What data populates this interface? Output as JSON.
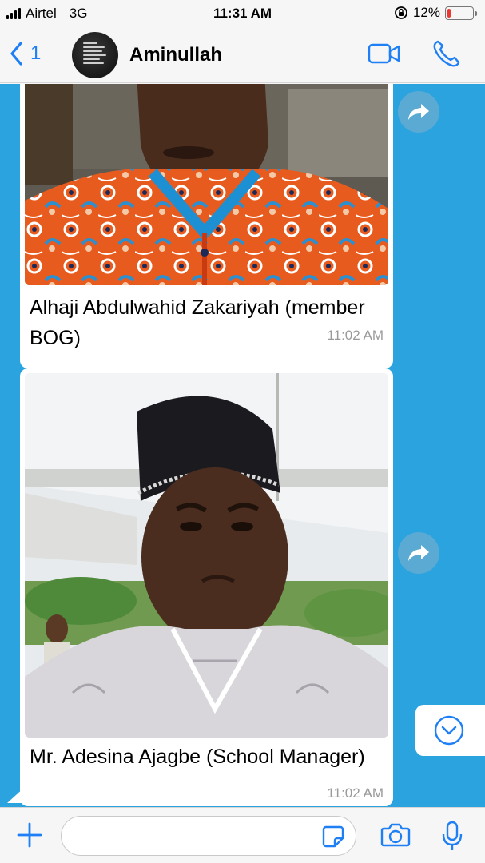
{
  "status_bar": {
    "carrier": "Airtel",
    "network": "3G",
    "time": "11:31 AM",
    "battery_percent": "12%",
    "battery_level": 0.12,
    "battery_color": "#e83a30"
  },
  "header": {
    "back_count": "1",
    "contact_name": "Aminullah",
    "accent_color": "#1f7ff5",
    "icons": [
      "video-call-icon",
      "voice-call-icon"
    ]
  },
  "messages": [
    {
      "caption": "Alhaji Abdulwahid Zakariyah (member BOG)",
      "time": "11:02 AM",
      "photo": "portrait of man in orange and blue patterned attire"
    },
    {
      "caption": "Mr. Adesina Ajagbe (School Manager)",
      "time": "11:02 AM",
      "photo": "portrait of man in black cap and white agbada"
    }
  ],
  "input": {
    "placeholder": "",
    "icons": [
      "plus-icon",
      "sticker-icon",
      "camera-icon",
      "microphone-icon"
    ]
  },
  "colors": {
    "chat_background": "#2aa3df",
    "forward_button": "#5aaad3"
  }
}
